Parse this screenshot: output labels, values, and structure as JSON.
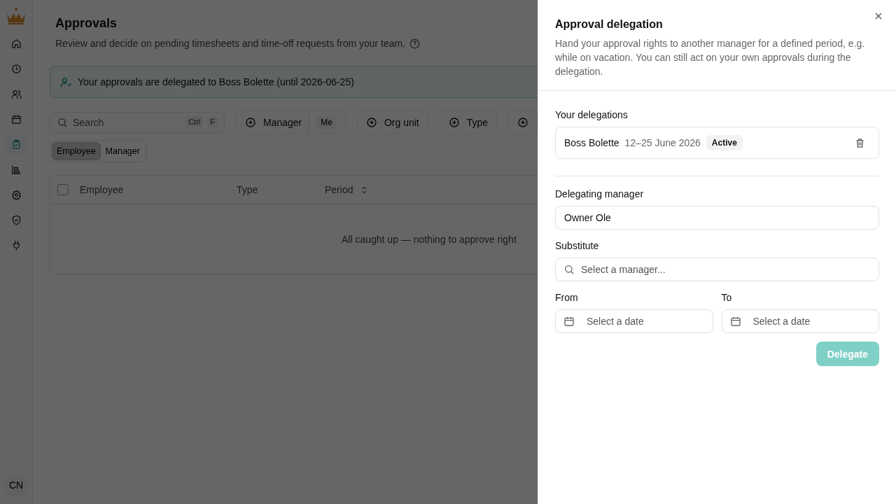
{
  "sidebar": {
    "nav": [
      {
        "selected": false
      },
      {
        "selected": false
      },
      {
        "selected": false
      },
      {
        "selected": false
      },
      {
        "selected": true
      },
      {
        "selected": false
      },
      {
        "selected": false
      },
      {
        "selected": false
      },
      {
        "selected": false
      }
    ],
    "avatar": "CN"
  },
  "page": {
    "title": "Approvals",
    "subtitle": "Review and decide on pending timesheets and time-off requests from your team.",
    "banner": "Your approvals are delegated to Boss Bolette (until 2026-06-25)",
    "search": {
      "placeholder": "Search",
      "keys": [
        "Ctrl",
        "F"
      ]
    },
    "filters": [
      {
        "label": "Manager",
        "value": "Me"
      },
      {
        "label": "Org unit"
      },
      {
        "label": "Type"
      },
      {
        "kind": "add"
      }
    ],
    "role_toggle": [
      {
        "label": "Employee",
        "selected": true
      },
      {
        "label": "Manager",
        "selected": false
      }
    ],
    "table": {
      "select_all_checked": false,
      "columns": [
        {
          "label": "Employee",
          "sortable": false
        },
        {
          "label": "Type",
          "sortable": false
        },
        {
          "label": "Period",
          "sortable": true
        }
      ],
      "empty_text": "All caught up — nothing to approve right"
    }
  },
  "drawer": {
    "title": "Approval delegation",
    "description": "Hand your approval rights to another manager for a defined period, e.g. while on vacation. You can still act on your own approvals during the delegation.",
    "section": "Your delegations",
    "delegations": [
      {
        "name": "Boss Bolette",
        "period": "12–25 June 2026",
        "status": "Active"
      }
    ],
    "delegating_manager": {
      "label": "Delegating manager",
      "value": "Owner Ole"
    },
    "substitute": {
      "label": "Substitute",
      "placeholder": "Select a manager..."
    },
    "from": {
      "label": "From",
      "placeholder": "Select a date"
    },
    "to": {
      "label": "To",
      "placeholder": "Select a date"
    },
    "button": {
      "label": "Delegate",
      "disabled": true
    }
  }
}
